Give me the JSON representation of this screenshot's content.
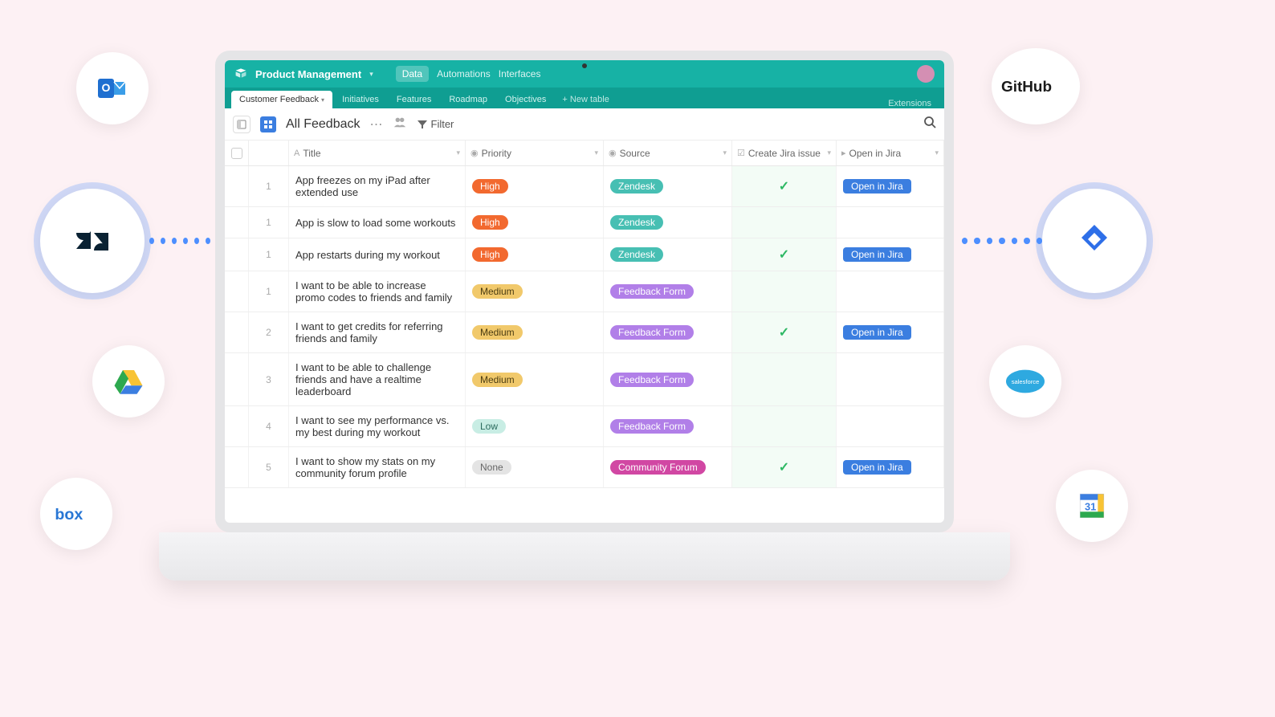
{
  "workspace": "Product Management",
  "nav": {
    "data": "Data",
    "automations": "Automations",
    "interfaces": "Interfaces"
  },
  "tabs": [
    "Customer Feedback",
    "Initiatives",
    "Features",
    "Roadmap",
    "Objectives"
  ],
  "newTable": "New table",
  "extensions": "Extensions",
  "view": {
    "name": "All Feedback",
    "filter": "Filter"
  },
  "columns": {
    "title": "Title",
    "priority": "Priority",
    "source": "Source",
    "createJira": "Create Jira issue",
    "openJira": "Open in Jira"
  },
  "rows": [
    {
      "n": "1",
      "title": "App freezes on my iPad after extended use",
      "priority": "High",
      "priorityClass": "high",
      "source": "Zendesk",
      "sourceClass": "zendesk",
      "created": true,
      "open": "Open in Jira"
    },
    {
      "n": "1",
      "title": "App is slow to load some workouts",
      "priority": "High",
      "priorityClass": "high",
      "source": "Zendesk",
      "sourceClass": "zendesk",
      "created": false,
      "open": ""
    },
    {
      "n": "1",
      "title": "App restarts during my workout",
      "priority": "High",
      "priorityClass": "high",
      "source": "Zendesk",
      "sourceClass": "zendesk",
      "created": true,
      "open": "Open in Jira"
    },
    {
      "n": "1",
      "title": "I want to be able to increase promo codes to friends and family",
      "priority": "Medium",
      "priorityClass": "medium",
      "source": "Feedback Form",
      "sourceClass": "feedback",
      "created": false,
      "open": ""
    },
    {
      "n": "2",
      "title": "I want to get credits for referring friends and family",
      "priority": "Medium",
      "priorityClass": "medium",
      "source": "Feedback Form",
      "sourceClass": "feedback",
      "created": true,
      "open": "Open in Jira"
    },
    {
      "n": "3",
      "title": "I want to be able to challenge friends and have a realtime leaderboard",
      "priority": "Medium",
      "priorityClass": "medium",
      "source": "Feedback Form",
      "sourceClass": "feedback",
      "created": false,
      "open": ""
    },
    {
      "n": "4",
      "title": "I want to see my performance vs. my best during my workout",
      "priority": "Low",
      "priorityClass": "low",
      "source": "Feedback Form",
      "sourceClass": "feedback",
      "created": false,
      "open": ""
    },
    {
      "n": "5",
      "title": "I want to show my stats on my community forum profile",
      "priority": "None",
      "priorityClass": "none",
      "source": "Community Forum",
      "sourceClass": "community",
      "created": true,
      "open": "Open in Jira"
    }
  ],
  "integrations": {
    "outlook": "Outlook",
    "zendesk": "Zendesk",
    "gdrive": "Google Drive",
    "box": "Box",
    "github": "GitHub",
    "jira": "Jira",
    "salesforce": "salesforce",
    "gcal": "Google Calendar"
  }
}
